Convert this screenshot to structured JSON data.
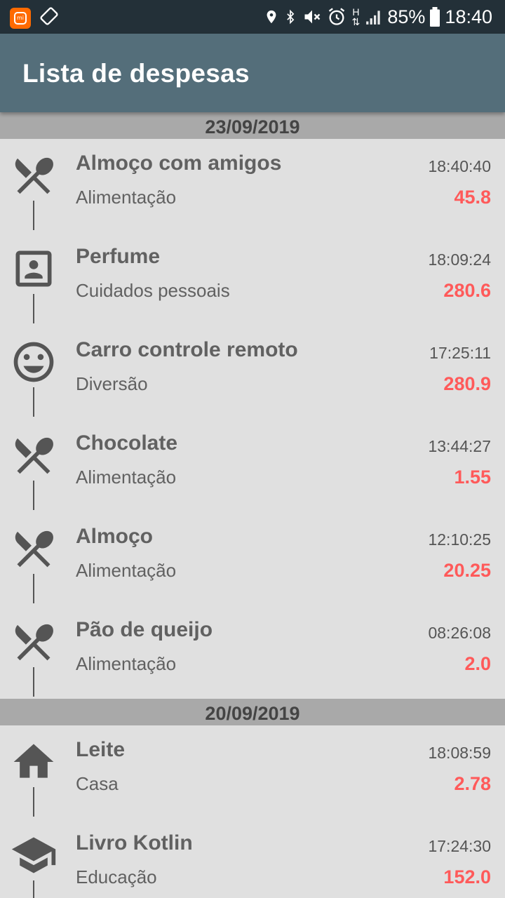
{
  "status_bar": {
    "battery": "85%",
    "time": "18:40",
    "network": "H"
  },
  "app_bar": {
    "title": "Lista de despesas"
  },
  "groups": [
    {
      "date": "23/09/2019",
      "items": [
        {
          "description": "Almoço com amigos",
          "category": "Alimentação",
          "time": "18:40:40",
          "amount": "45.8",
          "icon": "restaurant-icon"
        },
        {
          "description": "Perfume",
          "category": "Cuidados pessoais",
          "time": "18:09:24",
          "amount": "280.6",
          "icon": "portrait-icon"
        },
        {
          "description": "Carro controle remoto",
          "category": "Diversão",
          "time": "17:25:11",
          "amount": "280.9",
          "icon": "smiley-icon"
        },
        {
          "description": "Chocolate",
          "category": "Alimentação",
          "time": "13:44:27",
          "amount": "1.55",
          "icon": "restaurant-icon"
        },
        {
          "description": "Almoço",
          "category": "Alimentação",
          "time": "12:10:25",
          "amount": "20.25",
          "icon": "restaurant-icon"
        },
        {
          "description": "Pão de queijo",
          "category": "Alimentação",
          "time": "08:26:08",
          "amount": "2.0",
          "icon": "restaurant-icon"
        }
      ]
    },
    {
      "date": "20/09/2019",
      "items": [
        {
          "description": "Leite",
          "category": "Casa",
          "time": "18:08:59",
          "amount": "2.78",
          "icon": "home-icon"
        },
        {
          "description": "Livro Kotlin",
          "category": "Educação",
          "time": "17:24:30",
          "amount": "152.0",
          "icon": "school-icon"
        }
      ]
    }
  ],
  "colors": {
    "app_bar": "#546e7a",
    "status_bar": "#233038",
    "amount": "#ff5a5a",
    "date_header": "#a9a9a9",
    "background": "#e0e0e0"
  }
}
